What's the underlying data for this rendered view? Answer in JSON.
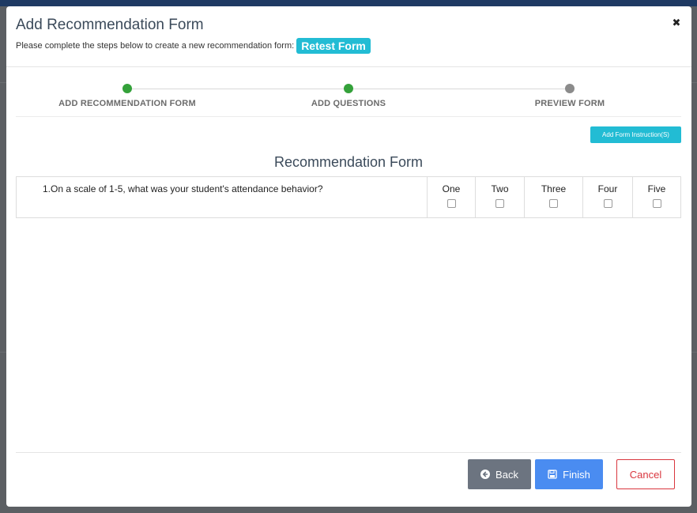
{
  "modal": {
    "title": "Add Recommendation Form",
    "subtitle": "Please complete the steps below to create a new recommendation form:",
    "form_name": "Retest Form",
    "close_glyph": "✖"
  },
  "stepper": {
    "steps": [
      {
        "label": "ADD RECOMMENDATION FORM",
        "state": "completed"
      },
      {
        "label": "ADD QUESTIONS",
        "state": "completed"
      },
      {
        "label": "PREVIEW FORM",
        "state": "current"
      }
    ]
  },
  "toolbar": {
    "add_instruction_label": "Add Form Instruction(S)"
  },
  "form": {
    "heading": "Recommendation Form",
    "questions": [
      {
        "text": "1.On a scale of 1-5, what was your student's attendance behavior?",
        "options": [
          "One",
          "Two",
          "Three",
          "Four",
          "Five"
        ],
        "checked": [
          false,
          false,
          false,
          false,
          false
        ]
      }
    ]
  },
  "footer": {
    "back_label": "Back",
    "finish_label": "Finish",
    "cancel_label": "Cancel"
  },
  "colors": {
    "accent": "#22bcd4",
    "step_complete": "#34a13a",
    "step_pending": "#8b8b8b",
    "finish": "#4a8cf1",
    "back": "#6c7480",
    "cancel": "#d9363e"
  },
  "icons": {
    "back": "arrow-circle-left-icon",
    "finish": "save-icon",
    "close": "close-icon"
  }
}
